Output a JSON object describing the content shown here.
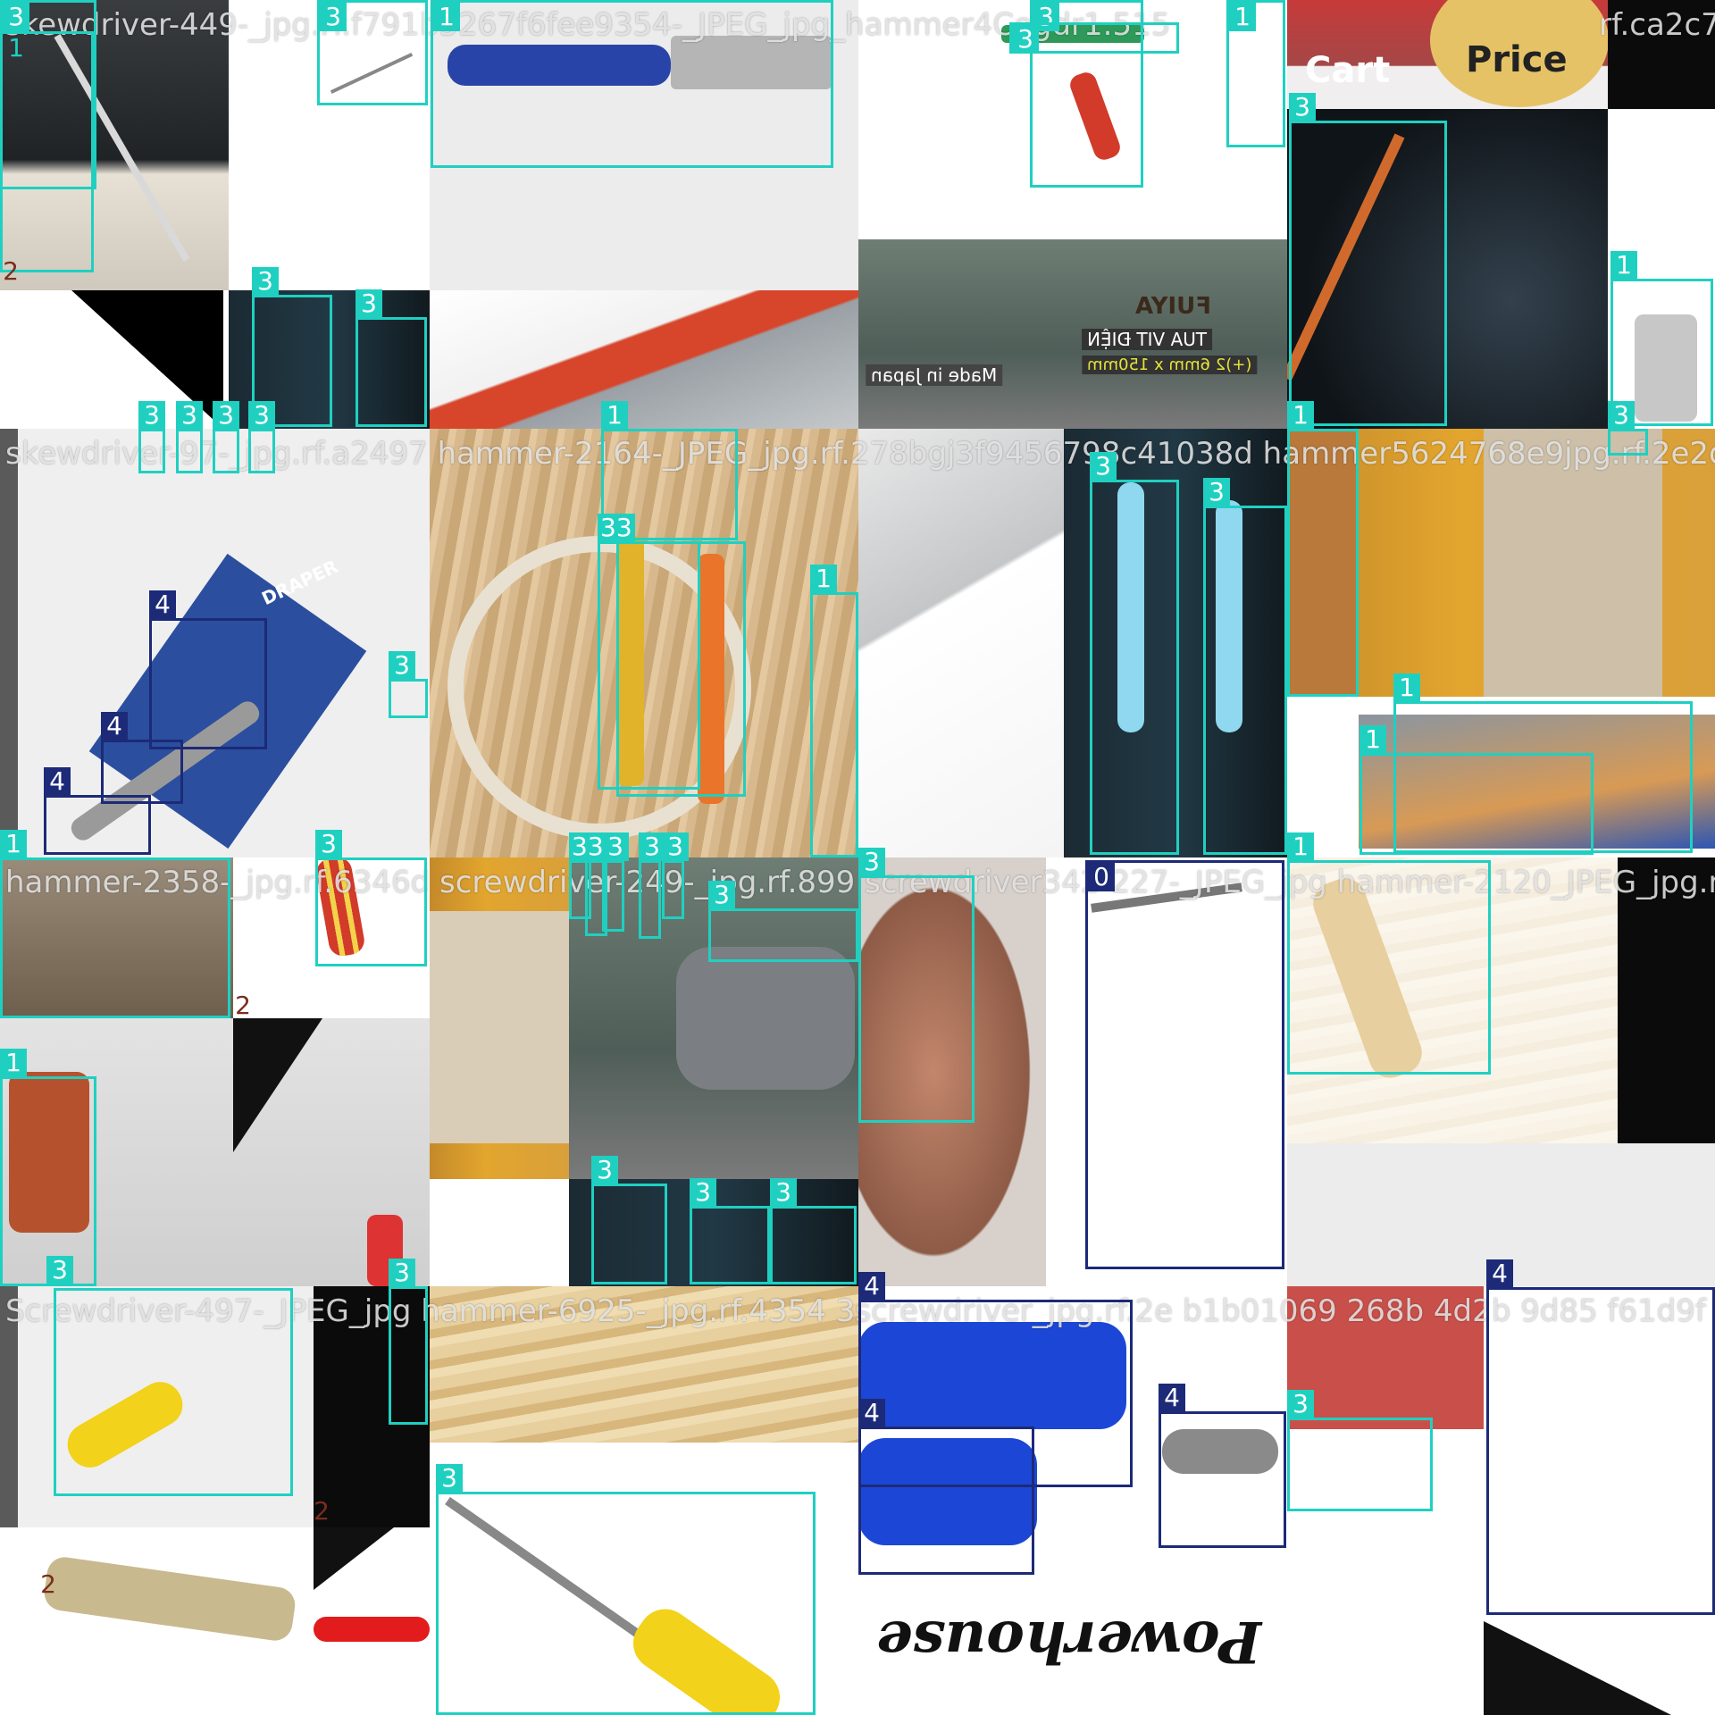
{
  "captions": {
    "c1": "skewdriver-449-_jpg.rf.f791b5267f6fee9354-_JPEG_jpg_hammer4Cegdr1.515",
    "c2": "rf.ca2c7",
    "c3": "skewdriver-97-_jpg.rf.a2497 hammer-2164-_JPEG_jpg.rf.278bgj3f9456798c41038d hammer5624768e9jpg.rf.2e2dfa",
    "c4": "hammer-2358-_jpg.rf.6346d screwdriver-249-_jpg.rf.899 screwdriver342-227-_JPEG_jpg hammer-2120_JPEG_jpg.r",
    "c5": "Screwdriver-497-_JPEG_jpg hammer-6925-_jpg.rf.4354 3screwdriver_jpg.rf.2e b1b01069 268b 4d2b 9d85 f61d9f"
  },
  "tile_text": {
    "cart": "Cart",
    "price": "Price",
    "fuiya": "FUIYA",
    "vn_label_1": "TUA VIT ĐIỆN",
    "vn_label_2": "(+)2 6mm x 150mm",
    "made_in": "Made in Japan",
    "draper": "DRAPER",
    "powerhouse": "Powerhouse"
  },
  "labels": {
    "l0": "0",
    "l1": "1",
    "l2": "2",
    "l3": "3",
    "l4": "4",
    "l33": "33"
  },
  "colors": {
    "class_1_3": "#1fd0c1",
    "class_0_4": "#1c2a78",
    "class_2": "#7a2d1d"
  }
}
